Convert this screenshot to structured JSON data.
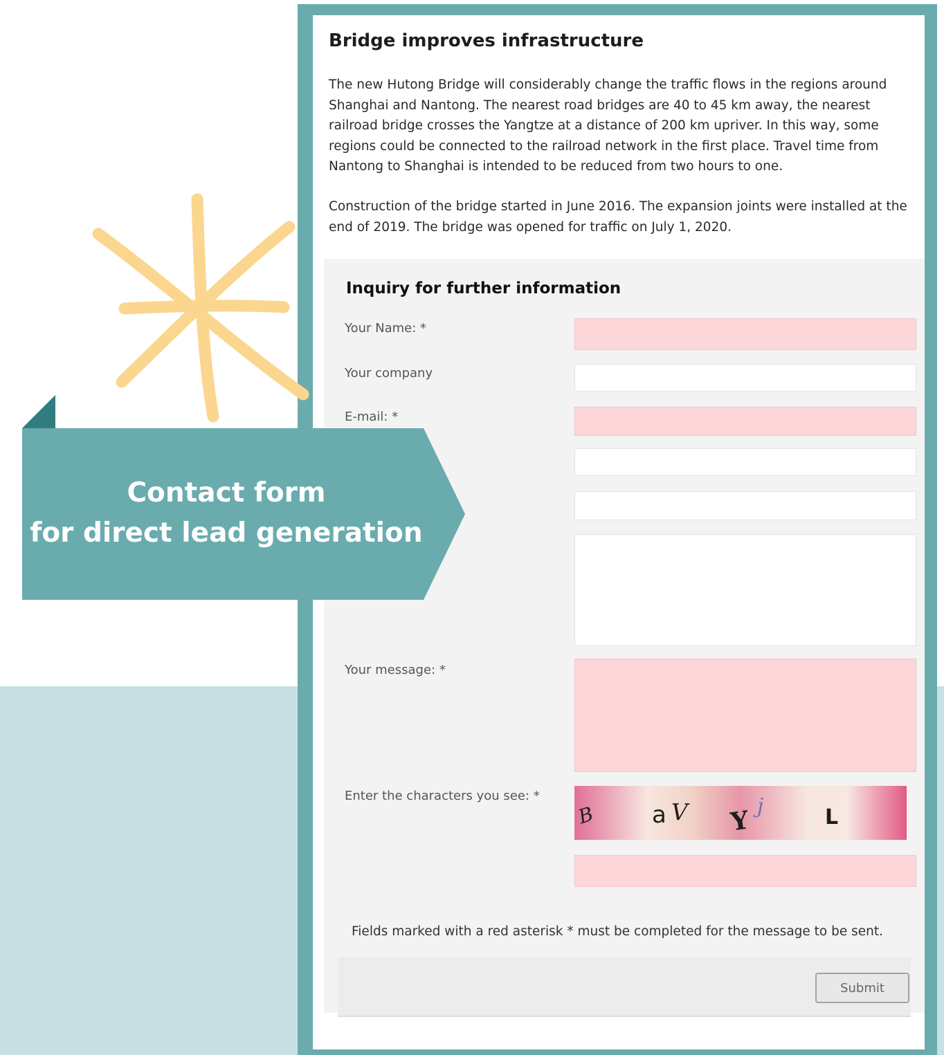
{
  "article": {
    "title": "Bridge improves infrastructure",
    "paragraph1": "The new Hutong Bridge will considerably change the traffic flows in the regions around\nShanghai and Nantong. The nearest road bridges are 40 to 45 km away, the nearest\nrailroad bridge crosses the Yangtze at a distance of 200 km upriver. In this way, some\nregions could be connected to the railroad network in the first place. Travel time from\nNantong to Shanghai is intended to be reduced from two hours to one.",
    "paragraph2": "Construction of the bridge started in June 2016. The expansion joints were installed at the\nend of 2019. The bridge was opened for traffic on July 1, 2020."
  },
  "form": {
    "title": "Inquiry for further information",
    "name_label": "Your Name: *",
    "company_label": "Your company",
    "email_label": "E-mail: *",
    "message_label": "Your message: *",
    "captcha_label": "Enter the characters you see: *",
    "captcha_chars": [
      "B",
      "a",
      "V",
      "Y",
      "j",
      "L"
    ],
    "required_note": "Fields marked with a red asterisk * must be completed for the message to be sent.",
    "submit_label": "Submit"
  },
  "callout": {
    "line1": "Contact form",
    "line2": "for direct lead generation"
  },
  "colors": {
    "frame": "#6aabae",
    "callout": "#6aabae",
    "callout_fold": "#2f7d80",
    "background_band": "#c9e0e2",
    "required_field": "#fcd6d8",
    "star": "#fbd68e"
  }
}
